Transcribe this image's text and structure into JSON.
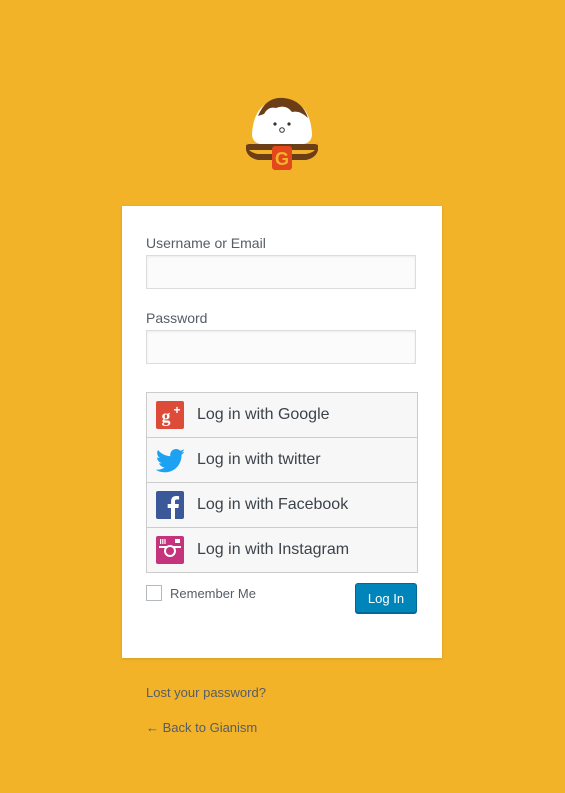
{
  "login_form": {
    "username_label": "Username or Email",
    "username_value": "",
    "password_label": "Password",
    "password_value": "",
    "social_buttons": [
      {
        "label": "Log in with Google",
        "icon": "google-plus-icon",
        "color": "#dd4b39"
      },
      {
        "label": "Log in with twitter",
        "icon": "twitter-icon",
        "color": "#1da1f2"
      },
      {
        "label": "Log in with Facebook",
        "icon": "facebook-icon",
        "color": "#3b5998"
      },
      {
        "label": "Log in with Instagram",
        "icon": "instagram-icon",
        "color": "#c4337b"
      }
    ],
    "remember_label": "Remember Me",
    "remember_checked": false,
    "submit_label": "Log In"
  },
  "footer": {
    "lost_password": "Lost your password?",
    "back_link": "← Back to Gianism"
  },
  "colors": {
    "background": "#f3b328",
    "primary_button": "#0085ba"
  }
}
